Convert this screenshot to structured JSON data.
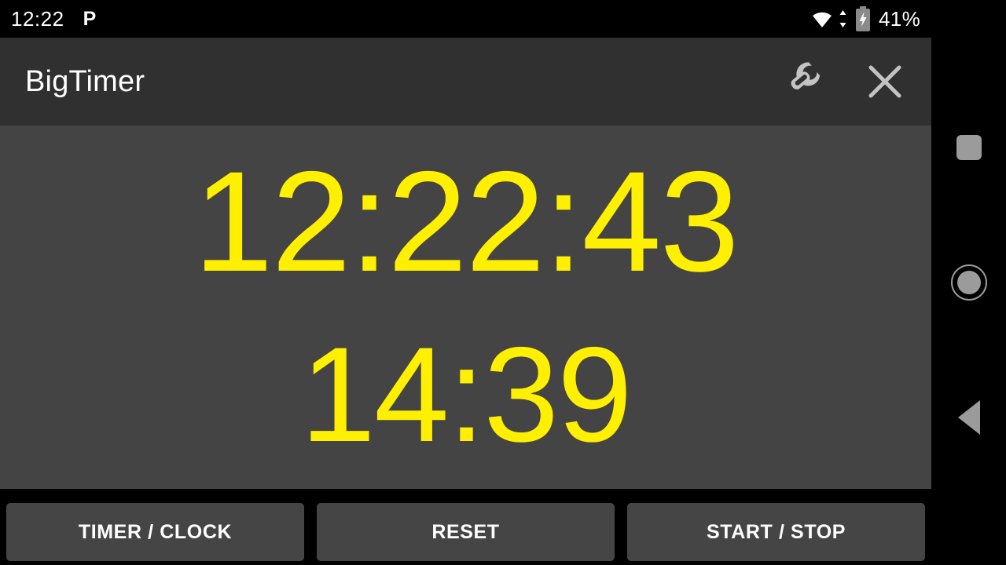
{
  "status_bar": {
    "clock": "12:22",
    "notification_icon": "P",
    "notification_icon_name": "pushbullet-icon",
    "wifi_icon": "wifi-icon",
    "data-transfer_icon": "data-transfer-arrows-icon",
    "battery_icon": "battery-charging-icon",
    "battery_percent": "41%"
  },
  "app": {
    "title": "BigTimer",
    "title_bar_bg": "#303030",
    "content_bg": "#444444",
    "settings_icon": "wrench-icon",
    "close_icon": "close-icon",
    "clock_value": "12:22:43",
    "timer_value": "14:39",
    "display_color": "#ffef00",
    "buttons": [
      {
        "label": "TIMER / CLOCK",
        "name": "timer-clock-button"
      },
      {
        "label": "RESET",
        "name": "reset-button"
      },
      {
        "label": "START / STOP",
        "name": "start-stop-button"
      }
    ]
  },
  "nav_bar": {
    "recents_icon": "recents-square-icon",
    "home_icon": "home-circle-icon",
    "back_icon": "back-triangle-icon",
    "icon_color": "#9b9b9b"
  }
}
